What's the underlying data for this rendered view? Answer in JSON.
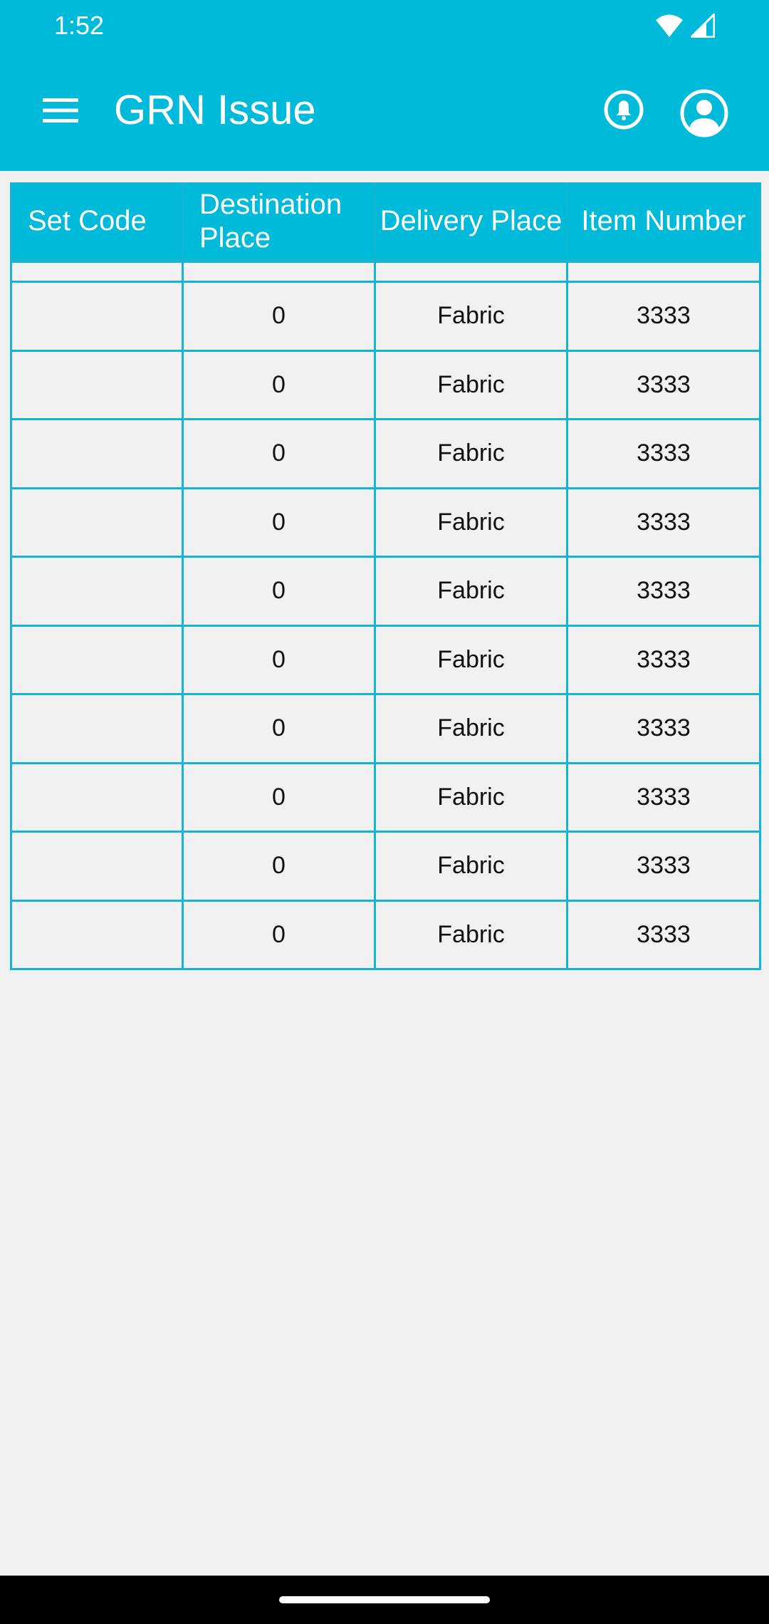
{
  "status_bar": {
    "time": "1:52",
    "icons": [
      "wifi-icon",
      "signal-icon"
    ]
  },
  "app_bar": {
    "title": "GRN Issue",
    "icons": [
      "menu-icon",
      "notification-bell-icon",
      "account-profile-icon"
    ]
  },
  "table": {
    "headers": [
      "Set Code",
      "Destination Place",
      "Delivery Place",
      "Item Number"
    ],
    "rows": [
      {
        "set_code": "",
        "destination_place": "0",
        "delivery_place": "Fabric",
        "item_number": "3333"
      },
      {
        "set_code": "",
        "destination_place": "0",
        "delivery_place": "Fabric",
        "item_number": "3333"
      },
      {
        "set_code": "",
        "destination_place": "0",
        "delivery_place": "Fabric",
        "item_number": "3333"
      },
      {
        "set_code": "",
        "destination_place": "0",
        "delivery_place": "Fabric",
        "item_number": "3333"
      },
      {
        "set_code": "",
        "destination_place": "0",
        "delivery_place": "Fabric",
        "item_number": "3333"
      },
      {
        "set_code": "",
        "destination_place": "0",
        "delivery_place": "Fabric",
        "item_number": "3333"
      },
      {
        "set_code": "",
        "destination_place": "0",
        "delivery_place": "Fabric",
        "item_number": "3333"
      },
      {
        "set_code": "",
        "destination_place": "0",
        "delivery_place": "Fabric",
        "item_number": "3333"
      },
      {
        "set_code": "",
        "destination_place": "0",
        "delivery_place": "Fabric",
        "item_number": "3333"
      },
      {
        "set_code": "",
        "destination_place": "0",
        "delivery_place": "Fabric",
        "item_number": "3333"
      }
    ]
  },
  "colors": {
    "primary": "#00bad9",
    "table_border": "#14b4d4",
    "background": "#f1f1f1",
    "nav_bar": "#000000"
  }
}
